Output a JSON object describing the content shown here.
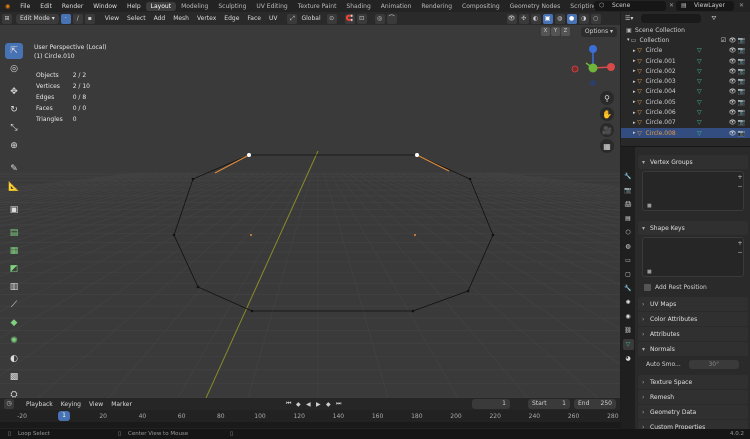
{
  "menu": [
    "File",
    "Edit",
    "Render",
    "Window",
    "Help"
  ],
  "workspaces": [
    "Layout",
    "Modeling",
    "Sculpting",
    "UV Editing",
    "Texture Paint",
    "Shading",
    "Animation",
    "Rendering",
    "Compositing",
    "Geometry Nodes",
    "Scripting"
  ],
  "scene": "Scene",
  "view_layer": "ViewLayer",
  "header": {
    "mode": "Edit Mode",
    "menus": [
      "View",
      "Select",
      "Add",
      "Mesh",
      "Vertex",
      "Edge",
      "Face",
      "UV"
    ],
    "orientation": "Global"
  },
  "viewport": {
    "perspective": "User Perspective (Local)",
    "object": "(1) Circle.010",
    "stats": [
      {
        "label": "Objects",
        "value": "2 / 2"
      },
      {
        "label": "Vertices",
        "value": "2 / 10"
      },
      {
        "label": "Edges",
        "value": "0 / 8"
      },
      {
        "label": "Faces",
        "value": "0 / 0"
      },
      {
        "label": "Triangles",
        "value": "0"
      }
    ],
    "options": "Options"
  },
  "outliner": {
    "scene_collection": "Scene Collection",
    "collection": "Collection",
    "objects": [
      "Circle",
      "Circle.001",
      "Circle.002",
      "Circle.003",
      "Circle.004",
      "Circle.005",
      "Circle.006",
      "Circle.007",
      "Circle.008"
    ]
  },
  "properties": {
    "vertex_groups": "Vertex Groups",
    "shape_keys": "Shape Keys",
    "add_rest_position": "Add Rest Position",
    "sections": [
      "UV Maps",
      "Color Attributes",
      "Attributes",
      "Normals"
    ],
    "auto_smooth": "Auto Smo...",
    "auto_smooth_value": "30°",
    "lower_sections": [
      "Texture Space",
      "Remesh",
      "Geometry Data",
      "Custom Properties"
    ]
  },
  "timeline": {
    "menus": [
      "Playback",
      "Keying",
      "View",
      "Marker"
    ],
    "current_frame": "1",
    "start_label": "Start",
    "start": "1",
    "end_label": "End",
    "end": "250",
    "ticks": [
      "-20",
      "1",
      "20",
      "40",
      "60",
      "80",
      "100",
      "120",
      "140",
      "160",
      "180",
      "200",
      "220",
      "240",
      "260",
      "280"
    ]
  },
  "status": {
    "left": "Loop Select",
    "middle": "Center View to Mouse",
    "version": "4.0.2"
  }
}
